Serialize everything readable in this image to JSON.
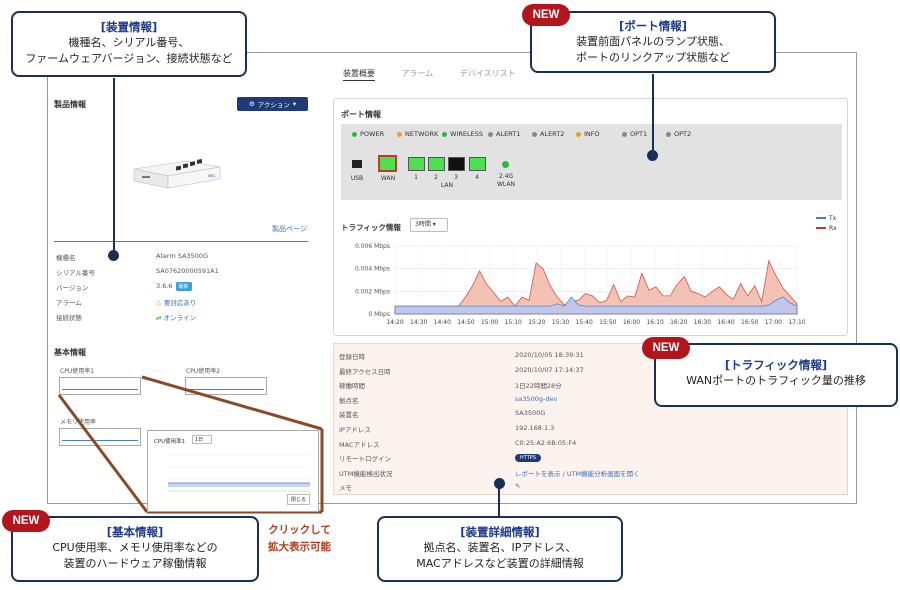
{
  "nav": {
    "tabs": [
      "装置概要",
      "アラーム",
      "デバイスリスト"
    ]
  },
  "product": {
    "title": "製品情報",
    "action_label": "アクション",
    "page_link": "製品ページ",
    "fields": [
      {
        "key": "機種名",
        "value": "Aterm SA3500G"
      },
      {
        "key": "シリアル番号",
        "value": "SA07620000591A1"
      },
      {
        "key": "バージョン",
        "value": "3.6.6",
        "badge": "最新"
      },
      {
        "key": "アラーム",
        "value": "要対応あり"
      },
      {
        "key": "接続状態",
        "value": "オンライン"
      }
    ]
  },
  "basic": {
    "title": "基本情報",
    "cpu1": "CPU使用率1",
    "cpu2": "CPU使用率2",
    "mem": "メモリ使用率",
    "popup_title": "CPU使用率1",
    "popup_select": "1日",
    "popup_close": "閉じる"
  },
  "port": {
    "title": "ポート情報",
    "leds": [
      {
        "label": "POWER",
        "color": "#2db83d"
      },
      {
        "label": "NETWORK",
        "color": "#e0a22b"
      },
      {
        "label": "WIRELESS",
        "color": "#2db83d"
      },
      {
        "label": "ALERT1",
        "color": "#888888"
      },
      {
        "label": "ALERT2",
        "color": "#888888"
      },
      {
        "label": "INFO",
        "color": "#e0a22b"
      },
      {
        "label": "OPT1",
        "color": "#888888"
      },
      {
        "label": "OPT2",
        "color": "#888888"
      }
    ],
    "ports": {
      "usb": "USB",
      "wan": "WAN",
      "lan1": "1",
      "lan2": "2",
      "lan3": "3",
      "lan4": "4",
      "lan": "LAN",
      "wlan": "2.4G\nWLAN"
    }
  },
  "traffic": {
    "title": "トラフィック情報",
    "select": "3時間",
    "legend": {
      "tx": "Tx",
      "rx": "Rx",
      "tx_color": "#4a7cc8",
      "rx_color": "#c0392b"
    }
  },
  "chart_data": {
    "type": "area",
    "x": [
      "14:20",
      "14:30",
      "14:40",
      "14:50",
      "15:00",
      "15:10",
      "15:20",
      "15:30",
      "15:40",
      "15:50",
      "16:00",
      "16:10",
      "16:20",
      "16:30",
      "16:40",
      "16:50",
      "17:00",
      "17:10"
    ],
    "ylabels": [
      "0 Mbps",
      "0.002 Mbps",
      "0.004 Mbps",
      "0.006 Mbps"
    ],
    "ylim": [
      0,
      0.006
    ],
    "series": [
      {
        "name": "Rx",
        "values": [
          0.0007,
          0.0007,
          0.0007,
          0.0007,
          0.0007,
          0.0007,
          0.0007,
          0.0007,
          0.0007,
          0.0007,
          0.0015,
          0.0025,
          0.0038,
          0.0026,
          0.0019,
          0.0011,
          0.0015,
          0.0007,
          0.0015,
          0.0012,
          0.0045,
          0.004,
          0.0025,
          0.0015,
          0.0008,
          0.0011,
          0.0012,
          0.0018,
          0.0016,
          0.001,
          0.0012,
          0.0026,
          0.0011,
          0.0016,
          0.0015,
          0.0036,
          0.0021,
          0.0024,
          0.0016,
          0.0016,
          0.0026,
          0.0033,
          0.002,
          0.0018,
          0.0015,
          0.002,
          0.0024,
          0.0017,
          0.0013,
          0.0027,
          0.0016,
          0.0025,
          0.0011,
          0.0047,
          0.0034,
          0.0023,
          0.0016,
          0.0009
        ]
      },
      {
        "name": "Tx",
        "values": [
          0.0007,
          0.0007,
          0.0007,
          0.0007,
          0.0007,
          0.0007,
          0.0007,
          0.0007,
          0.0007,
          0.0007,
          0.0007,
          0.0007,
          0.0007,
          0.0007,
          0.0007,
          0.0007,
          0.0007,
          0.0007,
          0.0007,
          0.0007,
          0.0007,
          0.0007,
          0.0007,
          0.0009,
          0.0007,
          0.0015,
          0.0008,
          0.0007,
          0.0007,
          0.0007,
          0.0007,
          0.0007,
          0.0007,
          0.0007,
          0.0007,
          0.0007,
          0.0007,
          0.0007,
          0.0007,
          0.0007,
          0.0007,
          0.0007,
          0.0007,
          0.0007,
          0.0007,
          0.0007,
          0.0007,
          0.0007,
          0.0007,
          0.0007,
          0.0007,
          0.0007,
          0.0007,
          0.0008,
          0.0012,
          0.0015,
          0.001,
          0.0007
        ]
      }
    ]
  },
  "detail": {
    "rows": [
      {
        "key": "登録日時",
        "value": "2020/10/05 18:39:31"
      },
      {
        "key": "最終アクセス日時",
        "value": "2020/10/07 17:14:37"
      },
      {
        "key": "稼働時間",
        "value": "1日22時間28分"
      },
      {
        "key": "拠点名",
        "value": "sa3500g-dev",
        "link": true
      },
      {
        "key": "装置名",
        "value": "SA3500G"
      },
      {
        "key": "IPアドレス",
        "value": "192.168.1.3"
      },
      {
        "key": "MACアドレス",
        "value": "C0:25:A2:6B:05:F4"
      },
      {
        "key": "リモートログイン",
        "value": "HTTPS",
        "badge": true
      },
      {
        "key": "UTM機能検出状況",
        "value": "レポートを表示 / UTM機能分析画面を開く",
        "link": true
      },
      {
        "key": "メモ",
        "value": ""
      }
    ]
  },
  "callouts": {
    "device_title": "[装置情報]",
    "device_body1": "機種名、シリアル番号、",
    "device_body2": "ファームウェアバージョン、接続状態など",
    "port_title": "[ポート情報]",
    "port_body1": "装置前面パネルのランプ状態、",
    "port_body2": "ポートのリンクアップ状態など",
    "traffic_title": "[トラフィック情報]",
    "traffic_body": "WANポートのトラフィック量の推移",
    "basic_title": "[基本情報]",
    "basic_body1": "CPU使用率、メモリ使用率などの",
    "basic_body2": "装置のハードウェア稼働情報",
    "detail_title": "[装置詳細情報]",
    "detail_body1": "拠点名、装置名、IPアドレス、",
    "detail_body2": "MACアドレスなど装置の詳細情報",
    "new": "NEW",
    "click1": "クリックして",
    "click2": "拡大表示可能"
  },
  "colors": {
    "navy": "#1a2f55",
    "new_badge": "#b3151d",
    "callout_title": "#1e3a8a"
  }
}
